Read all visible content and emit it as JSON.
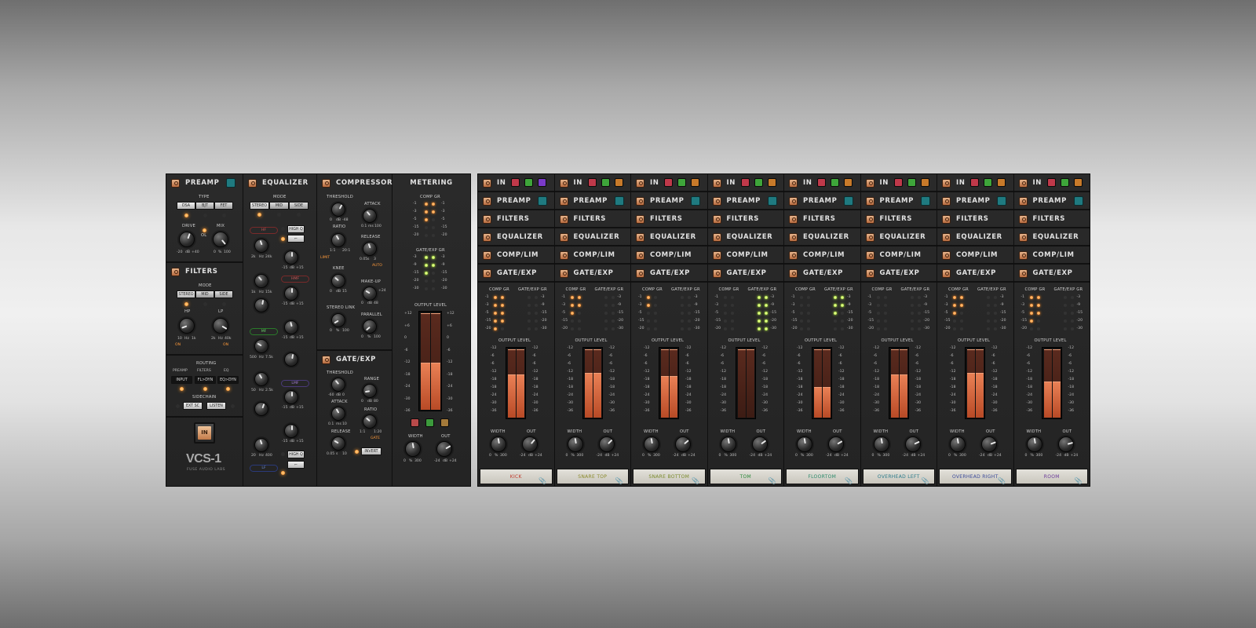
{
  "master": {
    "preamp": {
      "title": "PREAMP",
      "type_label": "TYPE",
      "types": [
        "DSA",
        "BJT",
        "FET"
      ],
      "drive_label": "DRIVE",
      "mix_label": "MIX",
      "ol_label": "OL",
      "drive_scale": [
        "-20",
        "dB",
        "+40"
      ],
      "mix_scale": [
        "0",
        "%",
        "100"
      ]
    },
    "filters": {
      "title": "FILTERS",
      "mode_label": "MODE",
      "modes": [
        "STEREO",
        "MID",
        "SIDE"
      ],
      "hp_label": "HP",
      "lp_label": "LP",
      "hp_scale": [
        "10",
        "Hz",
        "1k"
      ],
      "lp_scale": [
        "2k",
        "Hz",
        "40k"
      ],
      "on_label": "ON"
    },
    "routing": {
      "title": "ROUTING",
      "cols": [
        "PREAMP",
        "FILTERS",
        "EQ"
      ],
      "buttons": [
        "INPUT",
        "FL>DYN",
        "EQ>DYN"
      ],
      "sidechain_label": "SIDECHAIN",
      "sc_buttons": [
        "EXT SC",
        "LISTEN"
      ]
    },
    "in_button": "IN",
    "logo": "VCS-1",
    "maker": "FUSE AUDIO LABS",
    "equalizer": {
      "title": "EQUALIZER",
      "mode_label": "MODE",
      "modes": [
        "STEREO",
        "MID",
        "SIDE"
      ],
      "bands": [
        "HF",
        "HMF",
        "MF",
        "LMF",
        "LF"
      ],
      "high_q": "HIGH Q",
      "scales": {
        "hf": [
          "2k",
          "Hz",
          "24k"
        ],
        "hmf": [
          "1k",
          "Hz",
          "15k"
        ],
        "mf": [
          "500",
          "Hz",
          "7.5k"
        ],
        "lmf": [
          "50",
          "Hz",
          "2.5k"
        ],
        "lf": [
          "20",
          "Hz",
          "400"
        ],
        "gain": [
          "-15",
          "dB",
          "+15"
        ]
      }
    },
    "compressor": {
      "title": "COMPRESSOR",
      "labels": [
        "THRESHOLD",
        "ATTACK",
        "RATIO",
        "RELEASE",
        "KNEE",
        "MAKE-UP",
        "STEREO LINK",
        "PARALLEL"
      ],
      "limit": "LIMIT",
      "auto": "AUTO",
      "scales": {
        "threshold": [
          "0",
          "dB",
          "-48"
        ],
        "attack": [
          "0.1",
          "ms",
          "100"
        ],
        "ratio": [
          "1:1",
          "",
          "20:1"
        ],
        "release": [
          "0.05",
          "s",
          "3"
        ],
        "knee": [
          "0",
          "dB",
          "15"
        ],
        "makeup": [
          "0",
          "dB",
          "48"
        ],
        "link": [
          "0",
          "%",
          "100"
        ],
        "parallel": [
          "0",
          "%",
          "100"
        ],
        "makeup_top": "+24"
      }
    },
    "gate": {
      "title": "GATE/EXP",
      "labels": [
        "THRESHOLD",
        "RANGE",
        "ATTACK",
        "RATIO",
        "RELEASE"
      ],
      "invert": "INVERT",
      "gate": "GATE",
      "scales": {
        "threshold": [
          "-60",
          "dB",
          "0"
        ],
        "range": [
          "0",
          "dB",
          "80"
        ],
        "attack": [
          "0.1",
          "ms",
          "10"
        ],
        "ratio": [
          "1:1",
          "",
          "1:20"
        ],
        "release": [
          "0.05",
          "s",
          "10"
        ]
      }
    },
    "metering": {
      "title": "METERING",
      "comp_gr": "COMP GR",
      "gate_gr": "GATE/EXP GR",
      "output_level": "OUTPUT LEVEL",
      "gr_scale": [
        "-1",
        "-3",
        "-5",
        "-15",
        "-20"
      ],
      "gate_scale": [
        "-3",
        "-9",
        "-15",
        "-20",
        "-30"
      ],
      "out_scale": [
        "+12",
        "+6",
        "0",
        "-6",
        "-12",
        "-18",
        "-24",
        "-30",
        "-36"
      ],
      "width_label": "WIDTH",
      "out_label": "OUT",
      "width_scale": [
        "0",
        "%",
        "300"
      ],
      "out_knob_scale": [
        "-24",
        "dB",
        "+24"
      ]
    }
  },
  "strip_labels": {
    "in": "IN",
    "preamp": "PREAMP",
    "filters": "FILTERS",
    "equalizer": "EQUALIZER",
    "comp": "COMP/LIM",
    "gate": "GATE/EXP",
    "comp_gr": "COMP GR",
    "gate_gr": "GATE/EXP GR",
    "output_level": "OUTPUT LEVEL",
    "width": "WIDTH",
    "out": "OUT",
    "out_scale": [
      "-12",
      "-6",
      "-6",
      "-12",
      "-18",
      "-18",
      "-24",
      "-30",
      "-36"
    ],
    "gr_scale": [
      "-1",
      "-3",
      "-5",
      "-15",
      "-20"
    ],
    "gate_scale": [
      "-3",
      "-9",
      "-15",
      "-20",
      "-30"
    ],
    "width_scale": [
      "0",
      "%",
      "300"
    ],
    "out_knob_scale": [
      "-24",
      "dB",
      "+24"
    ]
  },
  "strips": [
    {
      "name": "KICK",
      "color": "#c0392b",
      "comp": [
        3,
        3,
        3,
        2,
        1
      ],
      "gate": [
        0,
        0,
        0,
        0,
        0
      ],
      "level": 0.6
    },
    {
      "name": "SNARE TOP",
      "color": "#8a8a2a",
      "comp": [
        2,
        2,
        1,
        0,
        0
      ],
      "gate": [
        0,
        0,
        0,
        0,
        0
      ],
      "level": 0.62
    },
    {
      "name": "SNARE BOTTOM",
      "color": "#7a8a2a",
      "comp": [
        1,
        1,
        0,
        0,
        0
      ],
      "gate": [
        0,
        0,
        0,
        0,
        0
      ],
      "level": 0.58
    },
    {
      "name": "TOM",
      "color": "#2a8a3a",
      "comp": [
        0,
        0,
        0,
        0,
        0
      ],
      "gate": [
        2,
        2,
        2,
        2,
        2
      ],
      "level": 0.0
    },
    {
      "name": "FLOORTOM",
      "color": "#2a8a6a",
      "comp": [
        0,
        0,
        0,
        0,
        0
      ],
      "gate": [
        2,
        2,
        1,
        0,
        0
      ],
      "level": 0.42
    },
    {
      "name": "OVERHEAD LEFT",
      "color": "#2a7a8a",
      "comp": [
        0,
        0,
        0,
        0,
        0
      ],
      "gate": [
        0,
        0,
        0,
        0,
        0
      ],
      "level": 0.6
    },
    {
      "name": "OVERHEAD RIGHT",
      "color": "#3a4a9a",
      "comp": [
        2,
        2,
        1,
        0,
        0
      ],
      "gate": [
        0,
        0,
        0,
        0,
        0
      ],
      "level": 0.62
    },
    {
      "name": "ROOM",
      "color": "#6a3a9a",
      "comp": [
        2,
        2,
        2,
        1,
        0
      ],
      "gate": [
        0,
        0,
        0,
        0,
        0
      ],
      "level": 0.5
    }
  ],
  "colors": {
    "strip_buttons": [
      "#c0394a",
      "#3ea53a",
      "#c87a2a",
      "#7a3ac8"
    ],
    "teal": "#1f7a80",
    "accent": "#ff8a1e"
  }
}
